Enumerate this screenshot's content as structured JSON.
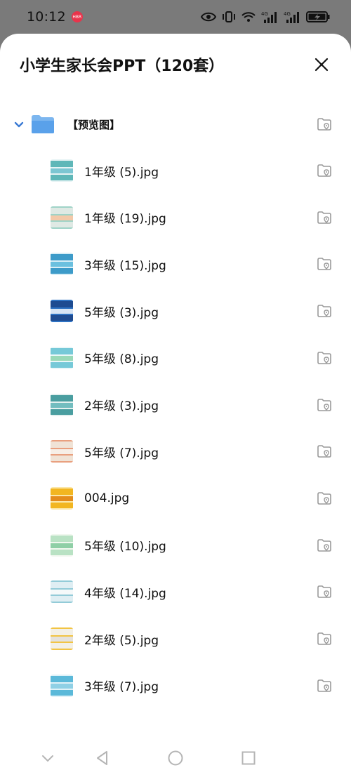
{
  "status": {
    "time": "10:12",
    "badge": "HBR",
    "icons": [
      "eye-icon",
      "vibrate-icon",
      "wifi-icon",
      "signal-4g-icon",
      "signal-4g-icon",
      "battery-charging-icon"
    ]
  },
  "dialog": {
    "title": "小学生家长会PPT（120套）",
    "close_icon": "close-icon"
  },
  "folder": {
    "name": "【预览图】",
    "expanded": true
  },
  "files": [
    {
      "name": "1年级 (5).jpg",
      "colors": [
        "#5fb7b8",
        "#e6f3f4",
        "#7cc6d2"
      ]
    },
    {
      "name": "1年级 (19).jpg",
      "colors": [
        "#dfe9e4",
        "#9fd3c7",
        "#f3c9a9"
      ]
    },
    {
      "name": "3年级 (15).jpg",
      "colors": [
        "#3d9bc9",
        "#d8eef6",
        "#6bc0df"
      ]
    },
    {
      "name": "5年级 (3).jpg",
      "colors": [
        "#1e4b91",
        "#2f73c4",
        "#d7e4f4"
      ]
    },
    {
      "name": "5年级 (8).jpg",
      "colors": [
        "#76c9d8",
        "#eaf7f8",
        "#9ad9b8"
      ]
    },
    {
      "name": "2年级 (3).jpg",
      "colors": [
        "#4a9ea0",
        "#e3f0ef",
        "#72bdbf"
      ]
    },
    {
      "name": "5年级 (7).jpg",
      "colors": [
        "#f0e3d6",
        "#e9a07f",
        "#f7efe7"
      ]
    },
    {
      "name": "004.jpg",
      "colors": [
        "#f2b621",
        "#fbe7a8",
        "#e48c1d"
      ]
    },
    {
      "name": "5年级 (10).jpg",
      "colors": [
        "#b9e2c4",
        "#f0f7ee",
        "#8fcfa6"
      ]
    },
    {
      "name": "4年级 (14).jpg",
      "colors": [
        "#dfeef3",
        "#93cbd8",
        "#f5f9fa"
      ]
    },
    {
      "name": "2年级 (5).jpg",
      "colors": [
        "#f3f0e6",
        "#f2c443",
        "#e5e2dc"
      ]
    },
    {
      "name": "3年级 (7).jpg",
      "colors": [
        "#5bb9d9",
        "#e0f2f8",
        "#8fd0e5"
      ]
    }
  ],
  "navbar": [
    "collapse-icon",
    "back-icon",
    "home-icon",
    "recents-icon"
  ],
  "accent": "#3b7bd4"
}
